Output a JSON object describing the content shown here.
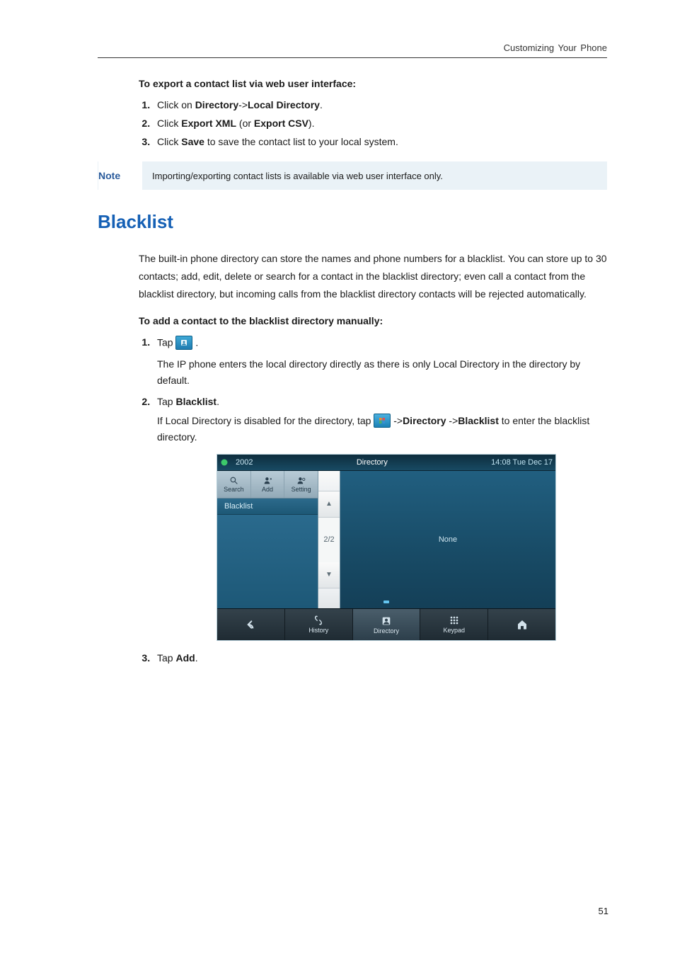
{
  "header": "Customizing Your Phone",
  "intro1": "To export a contact list via web user interface:",
  "steps1": {
    "s1a": "Click on ",
    "s1b": "Directory",
    "s1c": "->",
    "s1d": "Local Directory",
    "s1e": ".",
    "s2a": "Click ",
    "s2b": "Export XML",
    "s2c": " (or ",
    "s2d": "Export CSV",
    "s2e": ").",
    "s3a": "Click ",
    "s3b": "Save",
    "s3c": " to save the contact list to your local system."
  },
  "note": {
    "label": "Note",
    "text": "Importing/exporting contact lists is available via web user interface only."
  },
  "h1": "Blacklist",
  "para1": "The built-in phone directory can store the names and phone numbers for a blacklist. You can store up to 30 contacts; add, edit, delete or search for a contact in the blacklist directory; even call a contact from the blacklist directory, but incoming calls from the blacklist directory contacts will be rejected automatically.",
  "intro2": "To add a contact to the blacklist directory manually:",
  "steps2": {
    "s1a": "Tap ",
    "s1b": " .",
    "s1body": "The IP phone enters the local directory directly as there is only Local Directory in the directory by default.",
    "s2a": "Tap ",
    "s2b": "Blacklist",
    "s2c": ".",
    "s2body_a": "If Local Directory is disabled for the directory, tap ",
    "s2body_b": " ->",
    "s2body_c": "Directory",
    "s2body_d": " ->",
    "s2body_e": "Blacklist",
    "s2body_f": " to enter the blacklist directory.",
    "s3a": "Tap ",
    "s3b": "Add",
    "s3c": "."
  },
  "phone": {
    "ext": "2002",
    "title": "Directory",
    "clock": "14:08 Tue Dec 17",
    "actions": {
      "search": "Search",
      "add": "Add",
      "setting": "Setting"
    },
    "tab": "Blacklist",
    "scroll": {
      "up": "▲",
      "page": "2/2",
      "down": "▼"
    },
    "content": "None",
    "bottom": {
      "history": "History",
      "directory": "Directory",
      "keypad": "Keypad"
    }
  },
  "pageNumber": "51"
}
